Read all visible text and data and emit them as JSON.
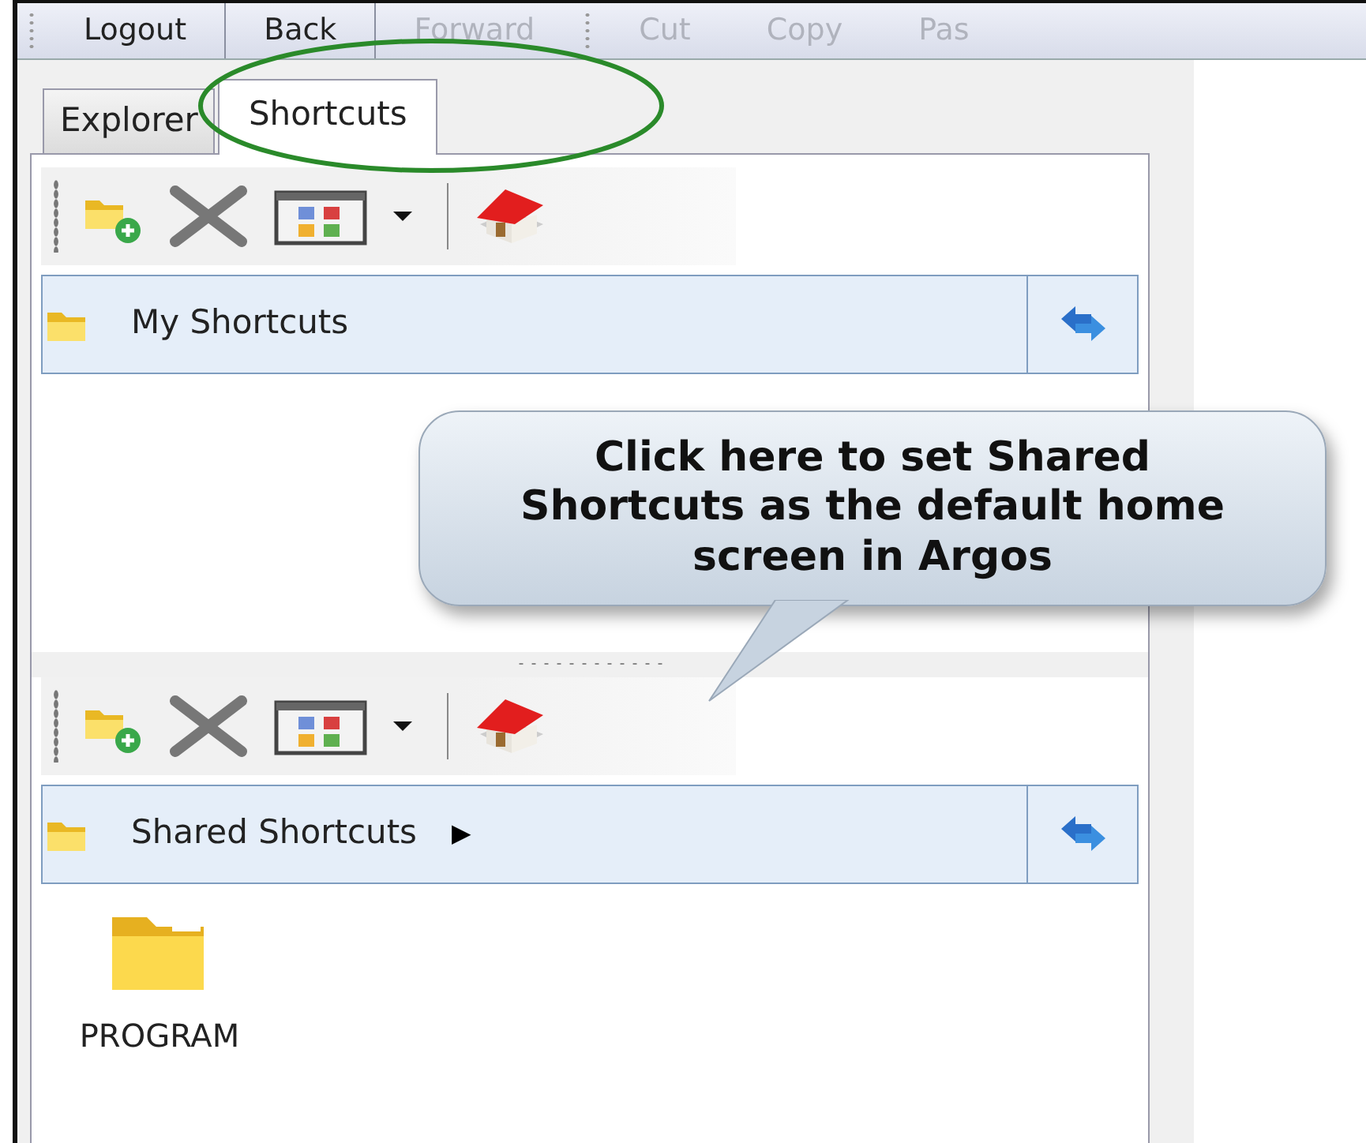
{
  "top_toolbar": {
    "nav_buttons": [
      {
        "label": "Logout",
        "disabled": false
      },
      {
        "label": "Back",
        "disabled": false
      },
      {
        "label": "Forward",
        "disabled": true
      }
    ],
    "edit_buttons": [
      {
        "label": "Cut",
        "disabled": true
      },
      {
        "label": "Copy",
        "disabled": true
      },
      {
        "label": "Pas",
        "disabled": true
      }
    ]
  },
  "tabs": [
    {
      "label": "Explorer",
      "selected": false
    },
    {
      "label": "Shortcuts",
      "selected": true
    }
  ],
  "sections": [
    {
      "title": "My Shortcuts"
    },
    {
      "title": "Shared Shortcuts",
      "menu_arrow": "▶",
      "items": [
        {
          "label": "PROGRAM"
        }
      ]
    }
  ],
  "callout": {
    "text": "Click here to set Shared Shortcuts as the default home screen in Argos"
  }
}
